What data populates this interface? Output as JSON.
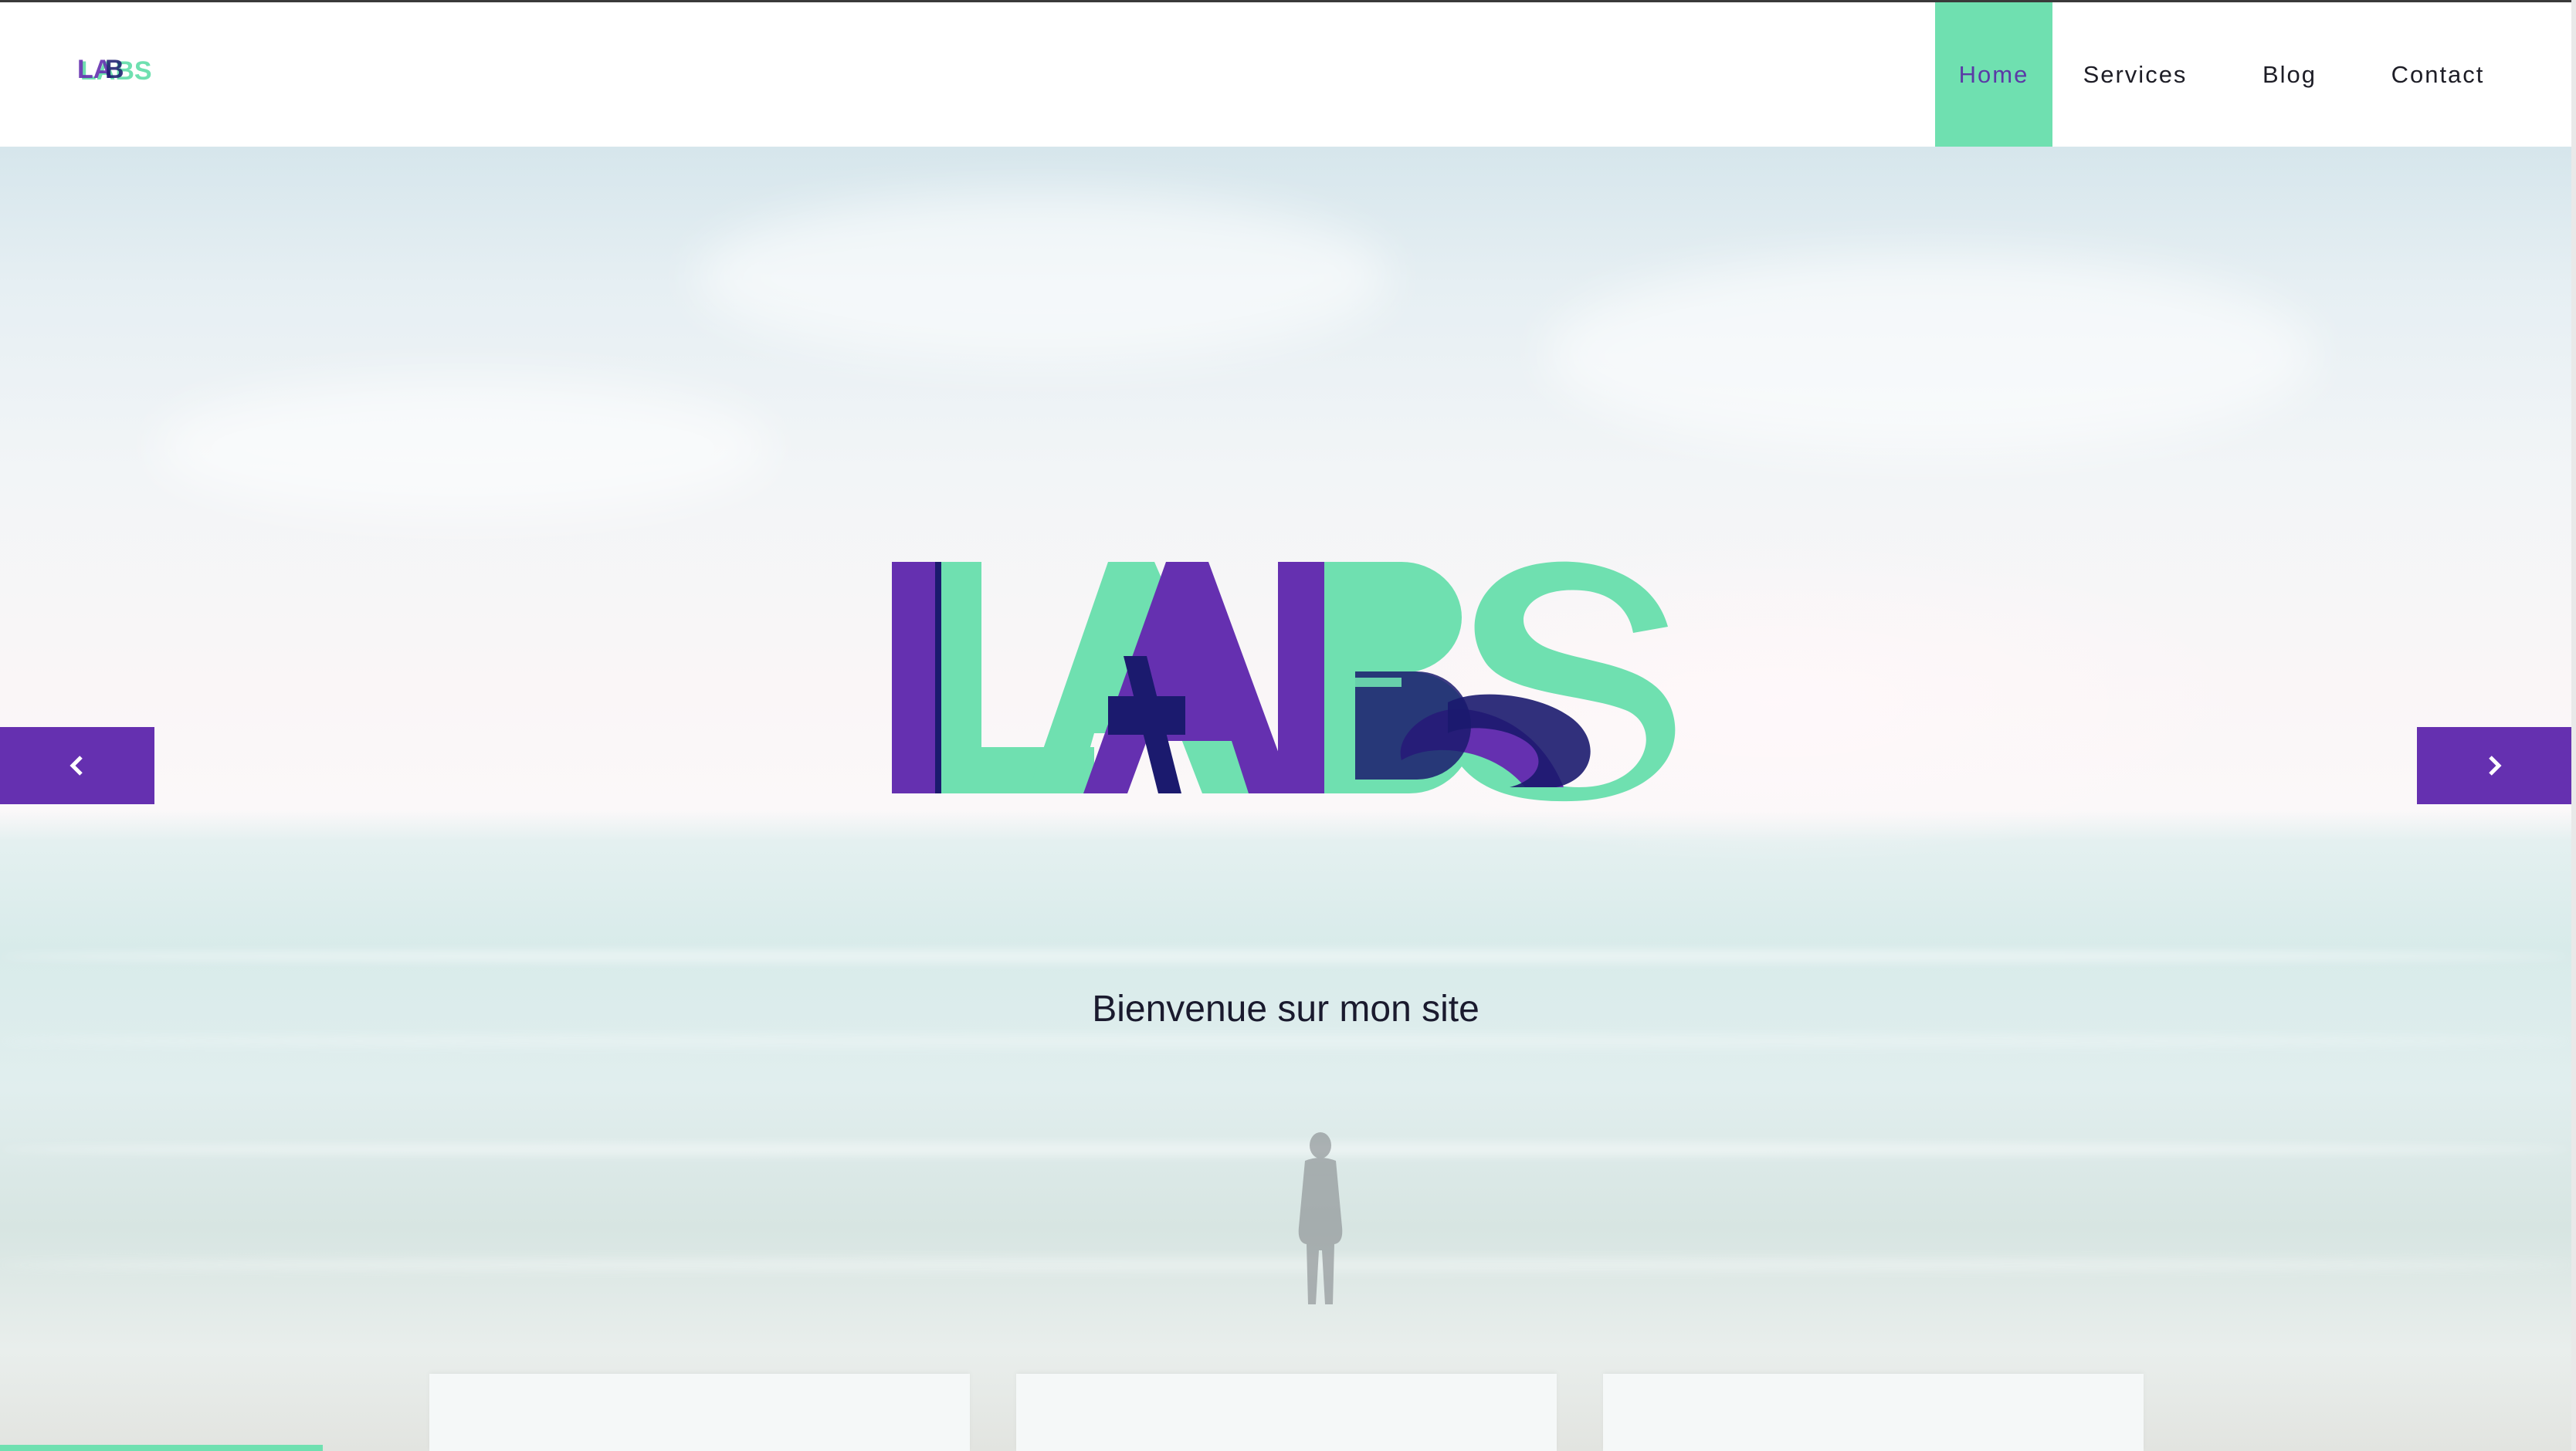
{
  "header": {
    "brand_text": "LABS",
    "nav": [
      {
        "label": "Home",
        "active": true
      },
      {
        "label": "Services",
        "active": false
      },
      {
        "label": "Blog",
        "active": false
      },
      {
        "label": "Contact",
        "active": false
      }
    ]
  },
  "hero": {
    "logo_text": "LABS",
    "tagline": "Bienvenue sur mon site",
    "prev_icon": "chevron-left-icon",
    "next_icon": "chevron-right-icon"
  },
  "colors": {
    "accent_green": "#6fe0b0",
    "accent_purple": "#6530b0",
    "accent_navy": "#1b1a6e"
  }
}
